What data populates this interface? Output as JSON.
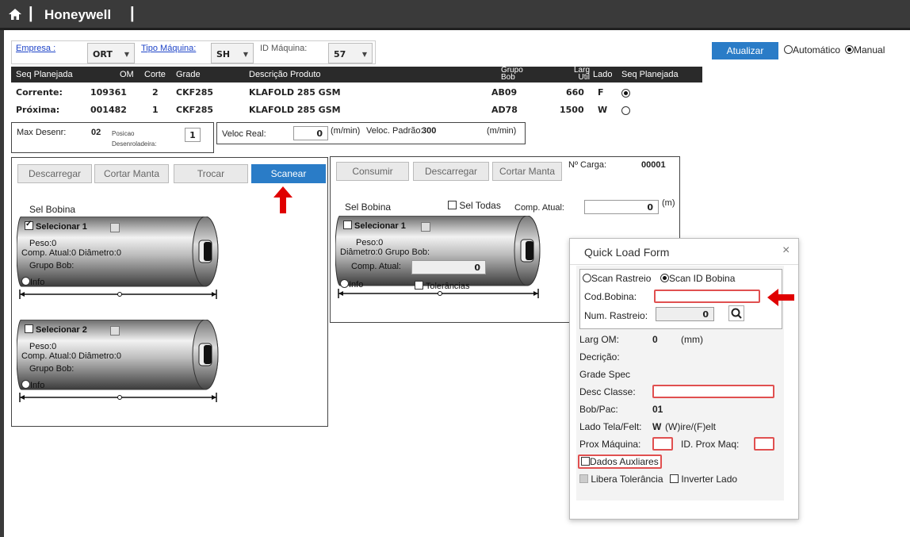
{
  "app": {
    "brand": "Honeywell"
  },
  "filters": {
    "empresa_label": "Empresa :",
    "empresa_value": "ORT",
    "tipo_label": "Tipo Máquina:",
    "tipo_value": "SH",
    "id_label": "ID Máquina:",
    "id_value": "57"
  },
  "actions": {
    "atualizar": "Atualizar",
    "automatico": "Automático",
    "manual": "Manual"
  },
  "table": {
    "headers": [
      "Seq Planejada",
      "OM",
      "Corte",
      "Grade",
      "Descrição Produto",
      "Grupo Bob",
      "Larg Util",
      "Lado",
      "Seq Planejada"
    ],
    "rows": [
      {
        "seq": "Corrente:",
        "om": "109361",
        "corte": "2",
        "grade": "CKF285",
        "desc": "KLAFOLD 285 GSM",
        "grupo": "AB09",
        "larg": "660",
        "lado": "F",
        "selected": true
      },
      {
        "seq": "Próxima:",
        "om": "001482",
        "corte": "1",
        "grade": "CKF285",
        "desc": "KLAFOLD 285 GSM",
        "grupo": "AD78",
        "larg": "1500",
        "lado": "W",
        "selected": false
      }
    ]
  },
  "info": {
    "max_label": "Max Desenr:",
    "max_value": "02",
    "pos_label1": "Posicao",
    "pos_label2": "Desenroladeira:",
    "pos_value": "1",
    "veloc_real_label": "Veloc Real:",
    "veloc_real_value": "0",
    "unit": "(m/min)",
    "veloc_padrao_label": "Veloc. Padrão:",
    "veloc_padrao_value": "300"
  },
  "left_panel": {
    "buttons": [
      "Descarregar",
      "Cortar Manta",
      "Trocar",
      "Scanear"
    ],
    "sel_bobina": "Sel Bobina",
    "rolls": [
      {
        "sel": "Selecionar 1",
        "checked": true,
        "peso": "Peso:0",
        "comp": "Comp. Atual:0",
        "diam": "Diâmetro:0",
        "grupo": "Grupo Bob:",
        "info": "Info",
        "dim": "0"
      },
      {
        "sel": "Selecionar 2",
        "checked": false,
        "peso": "Peso:0",
        "comp": "Comp. Atual:0",
        "diam": "Diâmetro:0",
        "grupo": "Grupo Bob:",
        "info": "Info",
        "dim": "0"
      }
    ]
  },
  "right_panel": {
    "buttons": [
      "Consumir",
      "Descarregar",
      "Cortar Manta"
    ],
    "carga_label": "Nº Carga:",
    "carga_value": "00001",
    "sel_bobina": "Sel Bobina",
    "sel_todas": "Sel Todas",
    "comp_atual_label": "Comp. Atual:",
    "comp_atual_value": "0",
    "unit_m": "(m)",
    "roll": {
      "sel": "Selecionar 1",
      "peso": "Peso:0",
      "diam": "Diâmetro:0",
      "grupo": "Grupo Bob:",
      "comp": "Comp. Atual:",
      "comp_value": "0",
      "info": "Info",
      "tol": "Tolerâncias",
      "dim": "0"
    }
  },
  "qlf": {
    "title": "Quick Load Form",
    "scan_rastreio": "Scan Rastreio",
    "scan_id": "Scan ID Bobina",
    "cod_bobina": "Cod.Bobina:",
    "num_rastreio": "Num. Rastreio:",
    "num_value": "0",
    "larg_om": "Larg OM:",
    "larg_value": "0",
    "mm": "(mm)",
    "decricao": "Decrição:",
    "grade_spec": "Grade Spec",
    "desc_classe": "Desc Classe:",
    "bob_pac": "Bob/Pac:",
    "bob_value": "01",
    "lado_tela": "Lado Tela/Felt:",
    "lado_value": "W",
    "lado_hint": "(W)ire/(F)elt",
    "prox_maq": "Prox Máquina:",
    "id_prox": "ID. Prox Maq:",
    "dados": "Dados Auxliares",
    "libera": "Libera Tolerância",
    "inverter": "Inverter Lado"
  },
  "colors": {
    "topbar": "#3a3a3a",
    "accent": "#2a7cc7",
    "arrow": "#e00000",
    "highlight": "#e05050"
  }
}
